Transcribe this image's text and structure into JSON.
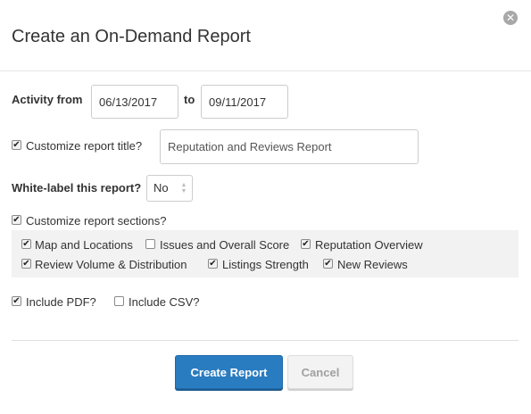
{
  "dialog": {
    "title": "Create an On-Demand Report",
    "close_icon": "close-icon"
  },
  "activity": {
    "label": "Activity from",
    "from_value": "06/13/2017",
    "to_label": "to",
    "to_value": "09/11/2017"
  },
  "customize_title": {
    "checked": true,
    "label": "Customize report title?",
    "value": "Reputation and Reviews Report"
  },
  "white_label": {
    "label": "White-label this report?",
    "value": "No"
  },
  "customize_sections": {
    "checked": true,
    "label": "Customize report sections?",
    "sections": [
      {
        "label": "Map and Locations",
        "checked": true
      },
      {
        "label": "Issues and Overall Score",
        "checked": false
      },
      {
        "label": "Reputation Overview",
        "checked": true
      },
      {
        "label": "Review Volume & Distribution",
        "checked": true
      },
      {
        "label": "Listings Strength",
        "checked": true
      },
      {
        "label": "New Reviews",
        "checked": true
      }
    ]
  },
  "include": {
    "pdf": {
      "label": "Include PDF?",
      "checked": true
    },
    "csv": {
      "label": "Include CSV?",
      "checked": false
    }
  },
  "buttons": {
    "create": "Create Report",
    "cancel": "Cancel"
  },
  "check_glyph": "✔"
}
